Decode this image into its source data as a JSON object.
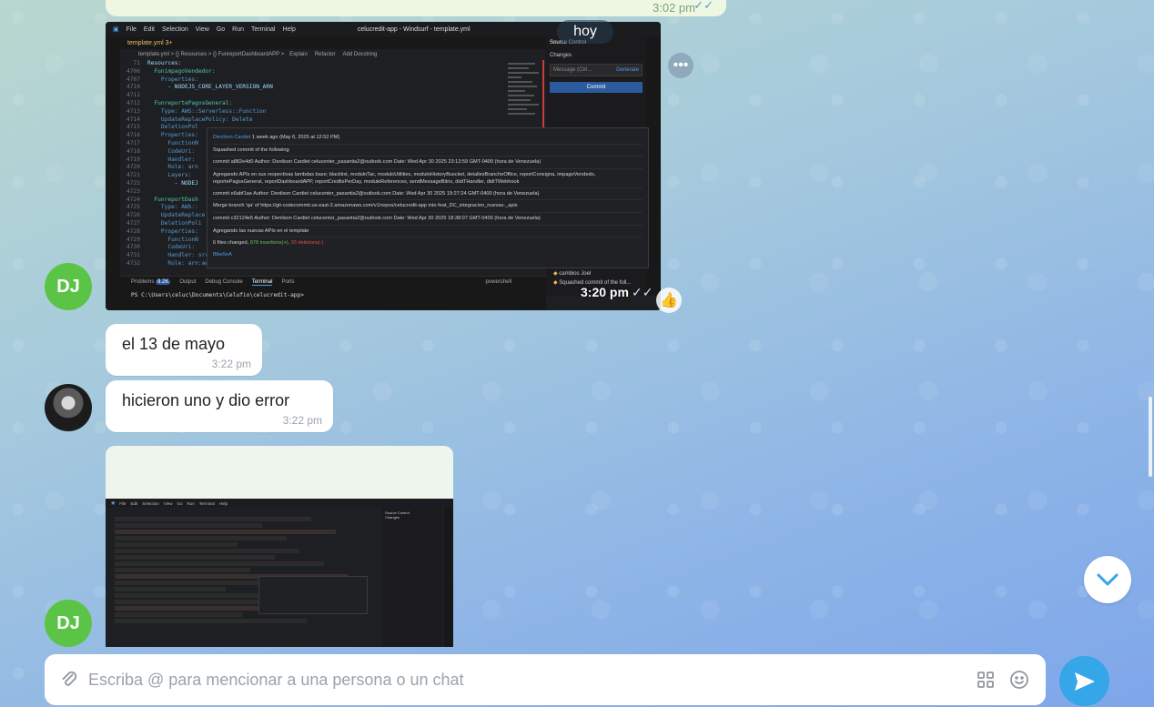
{
  "top_message": {
    "time": "3:02 pm",
    "status": "read"
  },
  "date_pill": "hoy",
  "avatars": {
    "dj": "DJ"
  },
  "image_message_1": {
    "time": "3:20 pm",
    "vscode": {
      "menu": [
        "File",
        "Edit",
        "Selection",
        "View",
        "Go",
        "Run",
        "Terminal",
        "Help"
      ],
      "window_title": "celucredit-app - Windsurf - template.yml",
      "tab": "template.yml 3+",
      "breadcrumb": "template.yml > {} Resources > {} FunreportDashboardAPP >",
      "breadcrumb_actions": [
        "Explain",
        "Refactor",
        "Add Docstring"
      ],
      "code_lines": [
        {
          "n": "71",
          "t": "Resources:"
        },
        {
          "n": "4706",
          "t": "  FunimpagoVendedor:"
        },
        {
          "n": "4707",
          "t": "    Properties:"
        },
        {
          "n": "4710",
          "t": "      - NODEJS_CORE_LAYER_VERSION_ARN"
        },
        {
          "n": "4711",
          "t": ""
        },
        {
          "n": "4712",
          "t": "  FunreportePagosGeneral:"
        },
        {
          "n": "4713",
          "t": "    Type: AWS::Serverless::Function"
        },
        {
          "n": "4714",
          "t": "    UpdateReplacePolicy: Delete"
        },
        {
          "n": "4715",
          "t": "    DeletionPol"
        },
        {
          "n": "4716",
          "t": "    Properties:"
        },
        {
          "n": "4717",
          "t": "      FunctionN"
        },
        {
          "n": "4718",
          "t": "      CodeUri:"
        },
        {
          "n": "4719",
          "t": "      Handler:"
        },
        {
          "n": "4720",
          "t": "      Role: arn"
        },
        {
          "n": "4721",
          "t": "      Layers:"
        },
        {
          "n": "4722",
          "t": "        - NODEJ"
        },
        {
          "n": "4723",
          "t": ""
        },
        {
          "n": "4724",
          "t": "  FunreportDash"
        },
        {
          "n": "4725",
          "t": "    Type: AWS::"
        },
        {
          "n": "4726",
          "t": "    UpdateReplace"
        },
        {
          "n": "4727",
          "t": "    DeletionPoli"
        },
        {
          "n": "4728",
          "t": "    Properties:"
        },
        {
          "n": "4729",
          "t": "      FunctionN"
        },
        {
          "n": "4730",
          "t": "      CodeUri:"
        },
        {
          "n": "4731",
          "t": "      Handler: src/reports-functions/reportAdminEstatistic/reporte_admin_stadist.reportAdminStadist"
        },
        {
          "n": "4732",
          "t": "      Role: arn:aws:iam::968462227128:role/GeneralRoleForLambdaSDK"
        }
      ],
      "hover": {
        "header_author": "Denilson Cardiet",
        "header_meta": "1 week ago (May 6, 2025 at 12:52 PM)",
        "lines": [
          "Squashed commit of the following",
          "commit a882e4d0 Author: Denilson Cardiet celucenter_pasantia2@outlook.com Date: Wed Apr 30 2025 23:13:59 GMT-0400 (hora de Venezuela)",
          "Agregando APIs en sus respectivas lambdas base; blacklist, moduloTac, moduloUtilities, moduloHistoryBuscket, detallesBrancheOffice, reportConsigna, impagoVendedo, reportePagosGeneral, reportDashboardAPP, reportCreditsPerDay, moduleReferences, sendMessageBitrix, didiTHandler, didiTWebhook",
          "commit e6abf1ae Author: Denilson Cardiet celucenter_pasantia2@outlook.com Date: Wed Apr 30 2025 19:27:24 GMT-0400 (hora de Venezuela)",
          "Merge branch 'qa' of https://git-codecommit.us-east-2.amazonaws.com/v1/repos/celucredit-app into feat_DC_integracion_nuevas-_apis",
          "commit c32124e5 Author: Denilson Cardiet celucenter_pasantia2@outlook.com Date: Wed Apr 30 2025 18:38:07 GMT-0400 (hora de Venezuela)",
          "Agregando las nuevas APIs en el template"
        ],
        "summary_prefix": "6 files changed,",
        "insertions": "878 insertions(+),",
        "deletions": "93 deletions(-)",
        "hash": "f8be5eA"
      },
      "source_control": {
        "title": "Source Control",
        "changes": "Changes",
        "message_placeholder": "Message (Ctrl...",
        "generate": "Generate",
        "commit": "Commit"
      },
      "graph_items": [
        "cambios  Joel",
        "Squashed commit of the foll..."
      ],
      "panel_tabs": [
        "Problems",
        "Output",
        "Debug Console",
        "Terminal",
        "Ports"
      ],
      "problems_count": "9.2K",
      "terminal_shell": "powershell",
      "terminal_line": "PS C:\\Users\\celuc\\Documents\\Celufio\\celucredit-app> "
    }
  },
  "messages": [
    {
      "text": "el 13 de mayo",
      "time": "3:22 pm"
    },
    {
      "text": "hicieron uno y dio error",
      "time": "3:22 pm"
    }
  ],
  "composer": {
    "placeholder": "Escriba @ para mencionar a una persona o un chat"
  },
  "colors": {
    "accent": "#35a6e8",
    "avatar_green": "#5bc447",
    "bubble_time": "#9aa4ad"
  },
  "icons": {
    "attach": "paperclip-icon",
    "apps": "apps-grid-icon",
    "emoji": "emoji-icon",
    "send": "send-icon",
    "scroll": "chevron-down-icon",
    "more": "more-dots-icon",
    "like": "thumbs-up-icon"
  }
}
